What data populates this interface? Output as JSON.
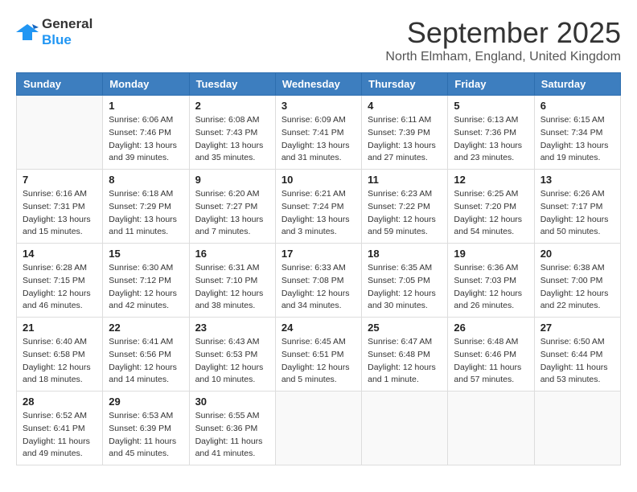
{
  "header": {
    "logo_line1": "General",
    "logo_line2": "Blue",
    "month": "September 2025",
    "location": "North Elmham, England, United Kingdom"
  },
  "days_of_week": [
    "Sunday",
    "Monday",
    "Tuesday",
    "Wednesday",
    "Thursday",
    "Friday",
    "Saturday"
  ],
  "weeks": [
    [
      {
        "day": "",
        "sunrise": "",
        "sunset": "",
        "daylight": ""
      },
      {
        "day": "1",
        "sunrise": "Sunrise: 6:06 AM",
        "sunset": "Sunset: 7:46 PM",
        "daylight": "Daylight: 13 hours and 39 minutes."
      },
      {
        "day": "2",
        "sunrise": "Sunrise: 6:08 AM",
        "sunset": "Sunset: 7:43 PM",
        "daylight": "Daylight: 13 hours and 35 minutes."
      },
      {
        "day": "3",
        "sunrise": "Sunrise: 6:09 AM",
        "sunset": "Sunset: 7:41 PM",
        "daylight": "Daylight: 13 hours and 31 minutes."
      },
      {
        "day": "4",
        "sunrise": "Sunrise: 6:11 AM",
        "sunset": "Sunset: 7:39 PM",
        "daylight": "Daylight: 13 hours and 27 minutes."
      },
      {
        "day": "5",
        "sunrise": "Sunrise: 6:13 AM",
        "sunset": "Sunset: 7:36 PM",
        "daylight": "Daylight: 13 hours and 23 minutes."
      },
      {
        "day": "6",
        "sunrise": "Sunrise: 6:15 AM",
        "sunset": "Sunset: 7:34 PM",
        "daylight": "Daylight: 13 hours and 19 minutes."
      }
    ],
    [
      {
        "day": "7",
        "sunrise": "Sunrise: 6:16 AM",
        "sunset": "Sunset: 7:31 PM",
        "daylight": "Daylight: 13 hours and 15 minutes."
      },
      {
        "day": "8",
        "sunrise": "Sunrise: 6:18 AM",
        "sunset": "Sunset: 7:29 PM",
        "daylight": "Daylight: 13 hours and 11 minutes."
      },
      {
        "day": "9",
        "sunrise": "Sunrise: 6:20 AM",
        "sunset": "Sunset: 7:27 PM",
        "daylight": "Daylight: 13 hours and 7 minutes."
      },
      {
        "day": "10",
        "sunrise": "Sunrise: 6:21 AM",
        "sunset": "Sunset: 7:24 PM",
        "daylight": "Daylight: 13 hours and 3 minutes."
      },
      {
        "day": "11",
        "sunrise": "Sunrise: 6:23 AM",
        "sunset": "Sunset: 7:22 PM",
        "daylight": "Daylight: 12 hours and 59 minutes."
      },
      {
        "day": "12",
        "sunrise": "Sunrise: 6:25 AM",
        "sunset": "Sunset: 7:20 PM",
        "daylight": "Daylight: 12 hours and 54 minutes."
      },
      {
        "day": "13",
        "sunrise": "Sunrise: 6:26 AM",
        "sunset": "Sunset: 7:17 PM",
        "daylight": "Daylight: 12 hours and 50 minutes."
      }
    ],
    [
      {
        "day": "14",
        "sunrise": "Sunrise: 6:28 AM",
        "sunset": "Sunset: 7:15 PM",
        "daylight": "Daylight: 12 hours and 46 minutes."
      },
      {
        "day": "15",
        "sunrise": "Sunrise: 6:30 AM",
        "sunset": "Sunset: 7:12 PM",
        "daylight": "Daylight: 12 hours and 42 minutes."
      },
      {
        "day": "16",
        "sunrise": "Sunrise: 6:31 AM",
        "sunset": "Sunset: 7:10 PM",
        "daylight": "Daylight: 12 hours and 38 minutes."
      },
      {
        "day": "17",
        "sunrise": "Sunrise: 6:33 AM",
        "sunset": "Sunset: 7:08 PM",
        "daylight": "Daylight: 12 hours and 34 minutes."
      },
      {
        "day": "18",
        "sunrise": "Sunrise: 6:35 AM",
        "sunset": "Sunset: 7:05 PM",
        "daylight": "Daylight: 12 hours and 30 minutes."
      },
      {
        "day": "19",
        "sunrise": "Sunrise: 6:36 AM",
        "sunset": "Sunset: 7:03 PM",
        "daylight": "Daylight: 12 hours and 26 minutes."
      },
      {
        "day": "20",
        "sunrise": "Sunrise: 6:38 AM",
        "sunset": "Sunset: 7:00 PM",
        "daylight": "Daylight: 12 hours and 22 minutes."
      }
    ],
    [
      {
        "day": "21",
        "sunrise": "Sunrise: 6:40 AM",
        "sunset": "Sunset: 6:58 PM",
        "daylight": "Daylight: 12 hours and 18 minutes."
      },
      {
        "day": "22",
        "sunrise": "Sunrise: 6:41 AM",
        "sunset": "Sunset: 6:56 PM",
        "daylight": "Daylight: 12 hours and 14 minutes."
      },
      {
        "day": "23",
        "sunrise": "Sunrise: 6:43 AM",
        "sunset": "Sunset: 6:53 PM",
        "daylight": "Daylight: 12 hours and 10 minutes."
      },
      {
        "day": "24",
        "sunrise": "Sunrise: 6:45 AM",
        "sunset": "Sunset: 6:51 PM",
        "daylight": "Daylight: 12 hours and 5 minutes."
      },
      {
        "day": "25",
        "sunrise": "Sunrise: 6:47 AM",
        "sunset": "Sunset: 6:48 PM",
        "daylight": "Daylight: 12 hours and 1 minute."
      },
      {
        "day": "26",
        "sunrise": "Sunrise: 6:48 AM",
        "sunset": "Sunset: 6:46 PM",
        "daylight": "Daylight: 11 hours and 57 minutes."
      },
      {
        "day": "27",
        "sunrise": "Sunrise: 6:50 AM",
        "sunset": "Sunset: 6:44 PM",
        "daylight": "Daylight: 11 hours and 53 minutes."
      }
    ],
    [
      {
        "day": "28",
        "sunrise": "Sunrise: 6:52 AM",
        "sunset": "Sunset: 6:41 PM",
        "daylight": "Daylight: 11 hours and 49 minutes."
      },
      {
        "day": "29",
        "sunrise": "Sunrise: 6:53 AM",
        "sunset": "Sunset: 6:39 PM",
        "daylight": "Daylight: 11 hours and 45 minutes."
      },
      {
        "day": "30",
        "sunrise": "Sunrise: 6:55 AM",
        "sunset": "Sunset: 6:36 PM",
        "daylight": "Daylight: 11 hours and 41 minutes."
      },
      {
        "day": "",
        "sunrise": "",
        "sunset": "",
        "daylight": ""
      },
      {
        "day": "",
        "sunrise": "",
        "sunset": "",
        "daylight": ""
      },
      {
        "day": "",
        "sunrise": "",
        "sunset": "",
        "daylight": ""
      },
      {
        "day": "",
        "sunrise": "",
        "sunset": "",
        "daylight": ""
      }
    ]
  ]
}
